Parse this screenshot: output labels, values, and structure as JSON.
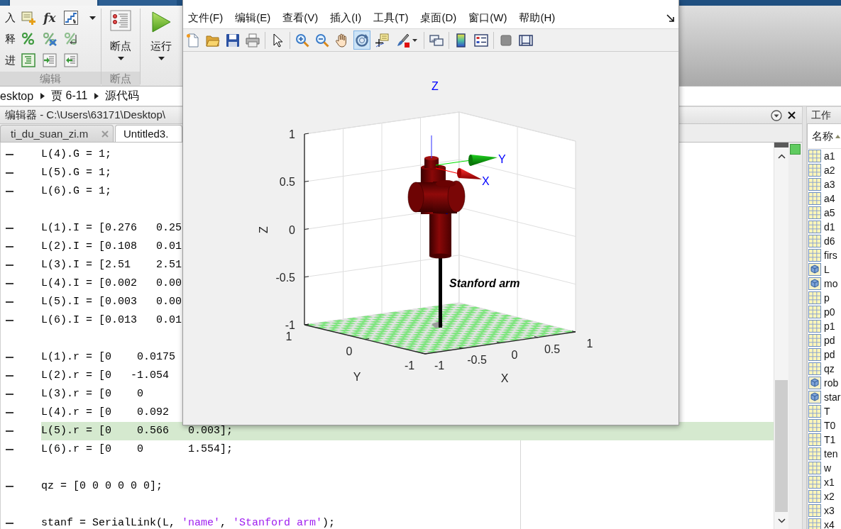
{
  "ribbon_tabs": [
    {
      "selected": false
    },
    {
      "selected": true
    },
    {
      "selected": false
    }
  ],
  "toolstrip": {
    "row_labels": [
      "入",
      "释",
      "进"
    ],
    "fx_label": "fx",
    "breakpoints_label": "断点",
    "run_label": "运行",
    "group_labels": [
      "编辑",
      "断点"
    ]
  },
  "address_bar": {
    "crumbs": [
      "esktop",
      "贾 6-11",
      "源代码"
    ]
  },
  "editor": {
    "title": "编辑器 - C:\\Users\\63171\\Desktop\\",
    "tabs": [
      {
        "label": "ti_du_suan_zi.m",
        "selected": false
      },
      {
        "label": "Untitled3.",
        "selected": true
      }
    ],
    "lines": [
      {
        "kind": "code",
        "text": "L(4).G = 1;",
        "executable": true,
        "highlighted": false
      },
      {
        "kind": "code",
        "text": "L(5).G = 1;",
        "executable": true,
        "highlighted": false
      },
      {
        "kind": "code",
        "text": "L(6).G = 1;",
        "executable": true,
        "highlighted": false
      },
      {
        "kind": "blank"
      },
      {
        "kind": "code",
        "text": "L(1).I = [0.276   0.25",
        "executable": true,
        "highlighted": false
      },
      {
        "kind": "code",
        "text": "L(2).I = [0.108   0.01",
        "executable": true,
        "highlighted": false
      },
      {
        "kind": "code",
        "text": "L(3).I = [2.51    2.51",
        "executable": true,
        "highlighted": false
      },
      {
        "kind": "code",
        "text": "L(4).I = [0.002   0.00",
        "executable": true,
        "highlighted": false
      },
      {
        "kind": "code",
        "text": "L(5).I = [0.003   0.00",
        "executable": true,
        "highlighted": false
      },
      {
        "kind": "code",
        "text": "L(6).I = [0.013   0.01",
        "executable": true,
        "highlighted": false
      },
      {
        "kind": "blank"
      },
      {
        "kind": "code",
        "text": "L(1).r = [0    0.0175",
        "executable": true,
        "highlighted": false
      },
      {
        "kind": "code",
        "text": "L(2).r = [0   -1.054",
        "executable": true,
        "highlighted": false
      },
      {
        "kind": "code",
        "text": "L(3).r = [0    0",
        "executable": true,
        "highlighted": false
      },
      {
        "kind": "code",
        "text": "L(4).r = [0    0.092",
        "executable": true,
        "highlighted": false
      },
      {
        "kind": "code",
        "text": "L(5).r = [0    0.566   0.003];",
        "executable": true,
        "highlighted": true
      },
      {
        "kind": "code",
        "text": "L(6).r = [0    0       1.554];",
        "executable": true,
        "highlighted": false
      },
      {
        "kind": "blank"
      },
      {
        "kind": "code",
        "text": "qz = [0 0 0 0 0 0];",
        "executable": true,
        "highlighted": false
      },
      {
        "kind": "blank"
      },
      {
        "kind": "code",
        "tokens": [
          {
            "kind": "plain",
            "text": "stanf = SerialLink(L, "
          },
          {
            "kind": "string",
            "text": "'name'"
          },
          {
            "kind": "plain",
            "text": ", "
          },
          {
            "kind": "string",
            "text": "'Stanford arm'"
          },
          {
            "kind": "plain",
            "text": ");"
          }
        ],
        "executable": true,
        "highlighted": false
      }
    ]
  },
  "workspace": {
    "title": "工作",
    "column": "名称",
    "variables": [
      {
        "name": "a1",
        "kind": "matrix"
      },
      {
        "name": "a2",
        "kind": "matrix"
      },
      {
        "name": "a3",
        "kind": "matrix"
      },
      {
        "name": "a4",
        "kind": "matrix"
      },
      {
        "name": "a5",
        "kind": "matrix"
      },
      {
        "name": "d1",
        "kind": "matrix"
      },
      {
        "name": "d6",
        "kind": "matrix"
      },
      {
        "name": "firs",
        "kind": "matrix"
      },
      {
        "name": "L",
        "kind": "object"
      },
      {
        "name": "mo",
        "kind": "object"
      },
      {
        "name": "p",
        "kind": "matrix"
      },
      {
        "name": "p0",
        "kind": "matrix"
      },
      {
        "name": "p1",
        "kind": "matrix"
      },
      {
        "name": "pd",
        "kind": "matrix"
      },
      {
        "name": "pd",
        "kind": "matrix"
      },
      {
        "name": "qz",
        "kind": "matrix"
      },
      {
        "name": "rob",
        "kind": "object"
      },
      {
        "name": "star",
        "kind": "object"
      },
      {
        "name": "T",
        "kind": "matrix"
      },
      {
        "name": "T0",
        "kind": "matrix"
      },
      {
        "name": "T1",
        "kind": "matrix"
      },
      {
        "name": "ten",
        "kind": "matrix"
      },
      {
        "name": "w",
        "kind": "matrix"
      },
      {
        "name": "x1",
        "kind": "matrix"
      },
      {
        "name": "x2",
        "kind": "matrix"
      },
      {
        "name": "x3",
        "kind": "matrix"
      },
      {
        "name": "x4",
        "kind": "matrix"
      }
    ]
  },
  "figure": {
    "menu": [
      "文件(F)",
      "编辑(E)",
      "查看(V)",
      "插入(I)",
      "工具(T)",
      "桌面(D)",
      "窗口(W)",
      "帮助(H)"
    ],
    "toolbar": [
      {
        "selected": false
      },
      {
        "selected": false
      },
      {
        "selected": false
      },
      {
        "selected": false
      },
      {
        "selected": false
      },
      {
        "selected": false
      },
      {
        "selected": false
      },
      {
        "selected": false
      },
      {
        "selected": true
      },
      {
        "selected": false
      },
      {
        "selected": false
      },
      {
        "selected": false
      },
      {
        "selected": false
      },
      {
        "selected": false
      },
      {
        "selected": false
      },
      {
        "selected": false
      }
    ],
    "plot": {
      "title": "Z",
      "zlabel": "Z",
      "ylabel": "Y",
      "xlabel": "X",
      "zticks": [
        "1",
        "0.5",
        "0",
        "-0.5",
        "-1"
      ],
      "yticks": [
        "1",
        "0",
        "-1"
      ],
      "xticks": [
        "-1",
        "-0.5",
        "0",
        "0.5",
        "1"
      ],
      "frame_labels": {
        "x": "X",
        "y": "Y"
      },
      "robot_label": "Stanford arm"
    }
  }
}
